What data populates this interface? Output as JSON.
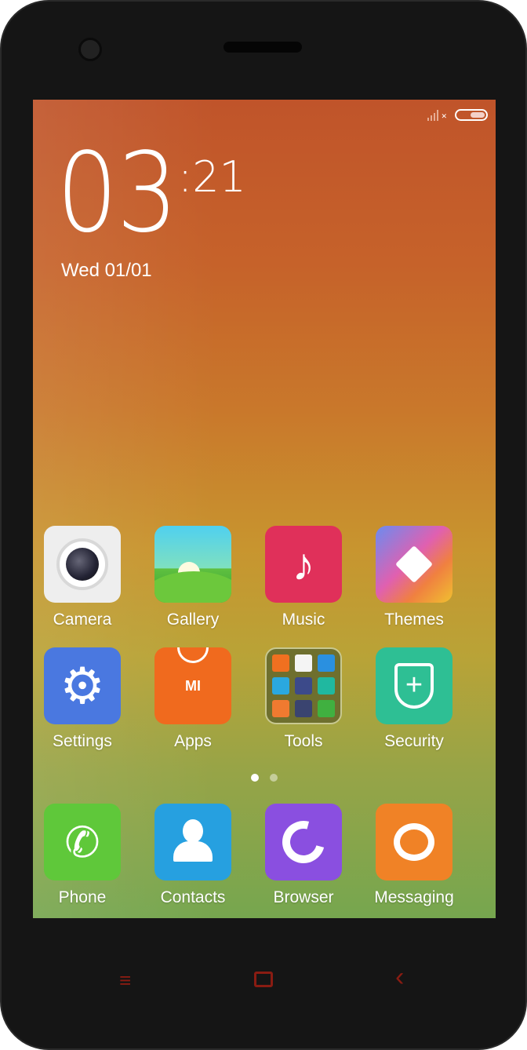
{
  "status": {
    "signal_icon": "signal-no-sim-icon",
    "battery_icon": "battery-icon"
  },
  "clock": {
    "hours": "03",
    "minutes": ":21",
    "date": "Wed 01/01"
  },
  "apps": [
    {
      "label": "Camera",
      "icon": "camera-icon",
      "color": "#eeeeee"
    },
    {
      "label": "Gallery",
      "icon": "gallery-icon",
      "color": "#4fc3e8"
    },
    {
      "label": "Music",
      "icon": "music-note-icon",
      "color": "#e0305a"
    },
    {
      "label": "Themes",
      "icon": "paintbrush-icon",
      "color": "#e86aa0"
    },
    {
      "label": "Settings",
      "icon": "gear-icon",
      "color": "#4a78e0"
    },
    {
      "label": "Apps",
      "icon": "mi-bag-icon",
      "color": "#f06a1e",
      "badge": "MI"
    },
    {
      "label": "Tools",
      "icon": "folder-icon",
      "color": "#6e6f2e"
    },
    {
      "label": "Security",
      "icon": "shield-plus-icon",
      "color": "#2ebf94"
    }
  ],
  "page_indicator": {
    "pages": 2,
    "current": 1
  },
  "dock": [
    {
      "label": "Phone",
      "icon": "phone-icon",
      "color": "#5fc83a"
    },
    {
      "label": "Contacts",
      "icon": "person-icon",
      "color": "#26a0e0"
    },
    {
      "label": "Browser",
      "icon": "browser-icon",
      "color": "#8a4fe0"
    },
    {
      "label": "Messaging",
      "icon": "chat-bubble-icon",
      "color": "#f08226"
    }
  ],
  "nav": {
    "menu": "≡",
    "home": "▢",
    "back": "‹"
  }
}
